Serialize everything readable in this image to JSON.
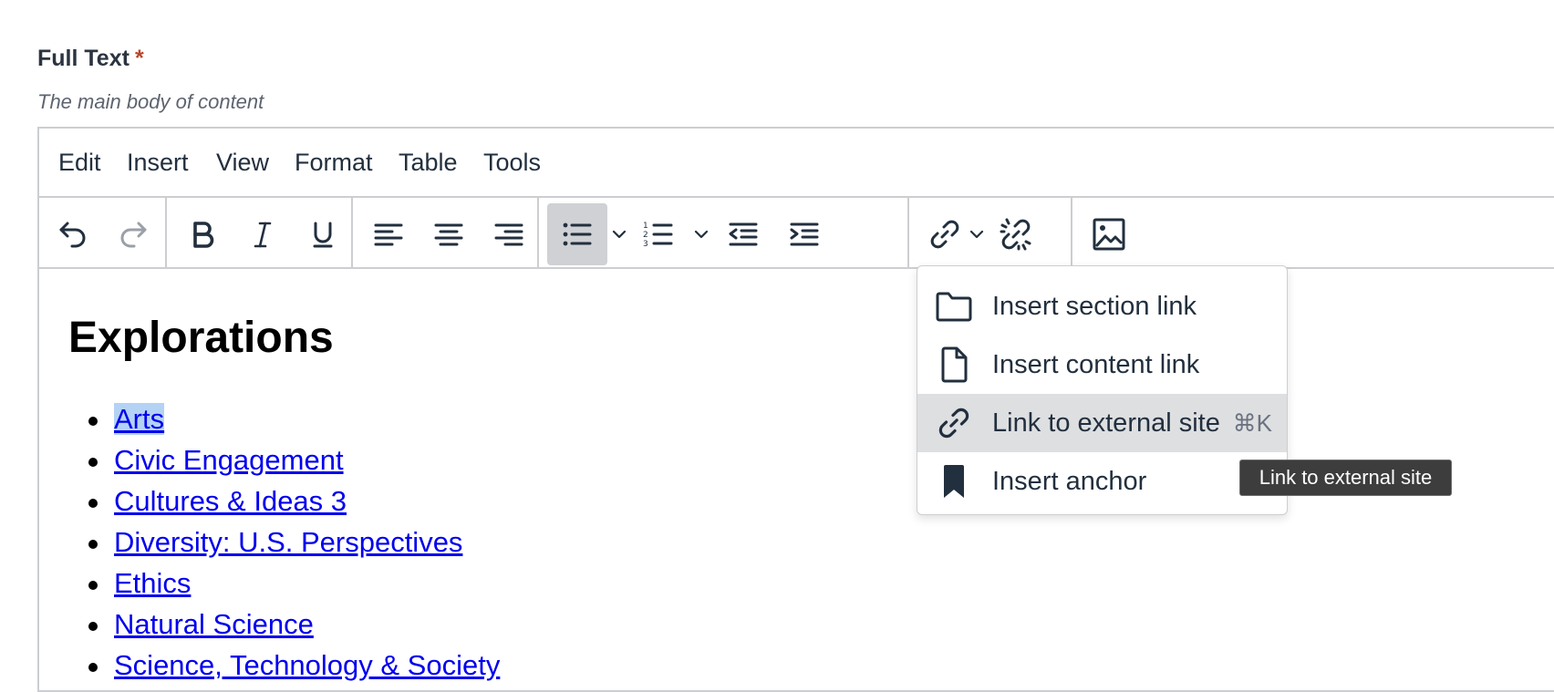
{
  "field": {
    "label": "Full Text",
    "required_marker": "*",
    "help": "The main body of content"
  },
  "menubar": [
    "Edit",
    "Insert",
    "View",
    "Format",
    "Table",
    "Tools"
  ],
  "toolbar": {
    "buttons": [
      "undo-icon",
      "redo-icon",
      "bold-icon",
      "italic-icon",
      "underline-icon",
      "align-left-icon",
      "align-center-icon",
      "align-right-icon",
      "bullet-list-icon",
      "numbered-list-icon",
      "outdent-icon",
      "indent-icon",
      "link-icon",
      "unlink-icon",
      "image-icon"
    ],
    "active": "bullet-list-icon"
  },
  "content": {
    "heading": "Explorations",
    "links": [
      "Arts",
      "Civic Engagement",
      "Cultures & Ideas 3",
      "Diversity: U.S. Perspectives",
      "Ethics",
      "Natural Science",
      "Science, Technology & Society"
    ],
    "selected_link": "Arts"
  },
  "link_menu": {
    "items": [
      {
        "label": "Insert section link",
        "icon": "folder-icon",
        "shortcut": ""
      },
      {
        "label": "Insert content link",
        "icon": "document-icon",
        "shortcut": ""
      },
      {
        "label": "Link to external site",
        "icon": "link-icon",
        "shortcut": "⌘K"
      },
      {
        "label": "Insert anchor",
        "icon": "bookmark-icon",
        "shortcut": ""
      }
    ],
    "highlighted": "Link to external site"
  },
  "tooltip": "Link to external site",
  "colors": {
    "link": "#0000ee",
    "selection": "#b4d2f4",
    "required": "#b5482c",
    "active_button": "#cfd1d4"
  }
}
